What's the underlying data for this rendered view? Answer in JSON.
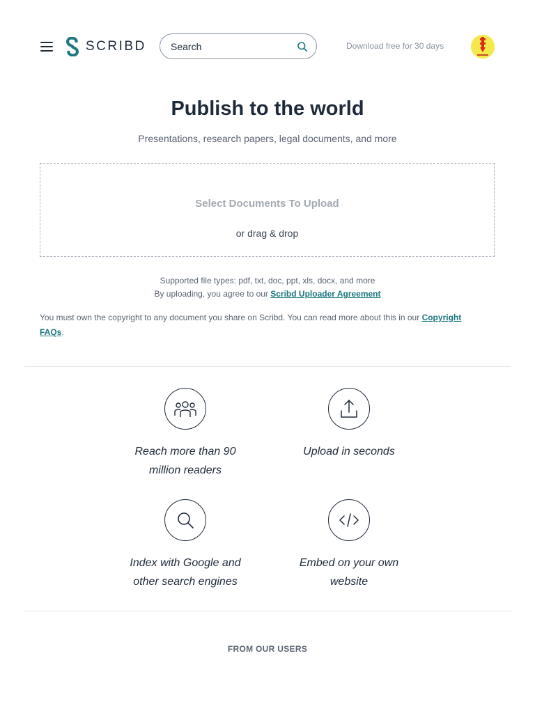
{
  "header": {
    "logo_text": "SCRIBD",
    "search_placeholder": "Search",
    "download_label": "Download free for 30 days",
    "icons": {
      "menu": "hamburger-menu-icon",
      "logo": "scribd-s-logo-icon",
      "search": "search-icon",
      "avatar": "user-avatar"
    },
    "colors": {
      "brand": "#1c7781",
      "text": "#1e2a3a",
      "avatar_bg": "#f4e94a"
    }
  },
  "hero": {
    "title": "Publish to the world",
    "subtitle": "Presentations, research papers, legal documents, and more"
  },
  "upload": {
    "select_label": "Select Documents To Upload",
    "drag_label": "or drag & drop",
    "filetypes": "Supported file types: pdf, txt, doc, ppt, xls, docx, and more",
    "agree_prefix": "By uploading, you agree to our ",
    "agree_link": "Scribd Uploader Agreement",
    "copyright_text": "You must own the copyright to any document you share on Scribd. You can read more about this in our ",
    "copyright_link": "Copyright FAQs",
    "copyright_suffix": "."
  },
  "features": [
    {
      "icon": "people-icon",
      "line1": "Reach more than 90",
      "line2": "million readers"
    },
    {
      "icon": "upload-icon",
      "line1": "Upload in seconds",
      "line2": ""
    },
    {
      "icon": "search-icon",
      "line1": "Index with Google and",
      "line2": "other search engines"
    },
    {
      "icon": "code-embed-icon",
      "line1": "Embed on your own",
      "line2": "website"
    }
  ],
  "testimonials": {
    "heading": "FROM OUR USERS"
  }
}
